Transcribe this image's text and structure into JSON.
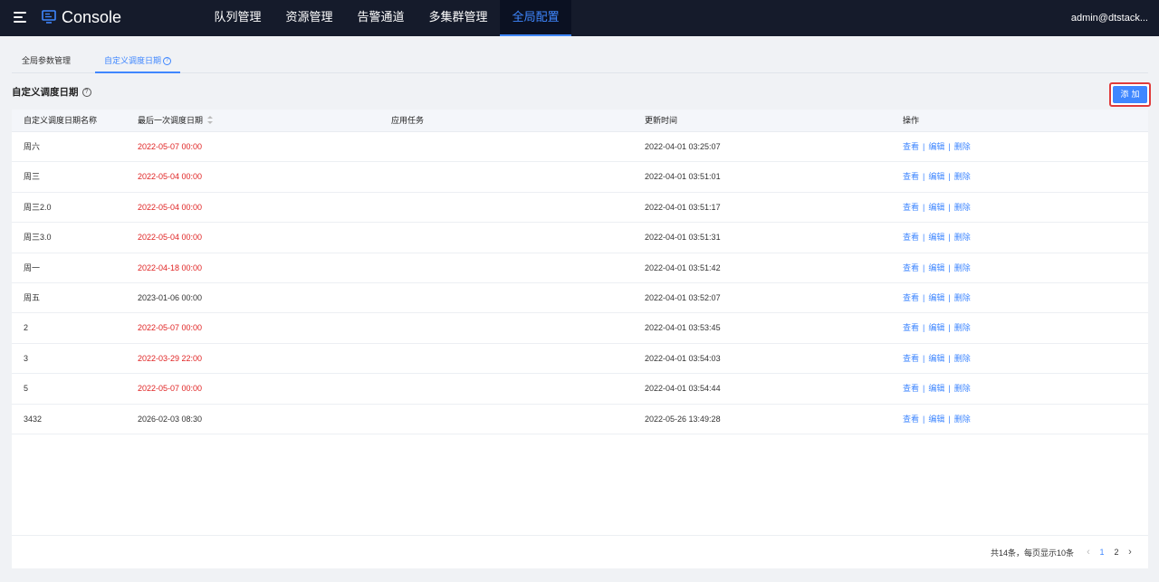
{
  "header": {
    "app_title": "Console",
    "nav": [
      "队列管理",
      "资源管理",
      "告警通道",
      "多集群管理",
      "全局配置"
    ],
    "active_nav": "全局配置",
    "user": "admin@dtstack..."
  },
  "tabs": [
    {
      "label": "全局参数管理",
      "active": false
    },
    {
      "label": "自定义调度日期",
      "active": true
    }
  ],
  "section": {
    "title": "自定义调度日期",
    "add_label": "添加"
  },
  "table": {
    "columns": [
      "自定义调度日期名称",
      "最后一次调度日期",
      "应用任务",
      "更新时间",
      "操作"
    ],
    "rows": [
      {
        "name": "周六",
        "last_date": "2022-05-07 00:00",
        "expired": true,
        "tasks": "",
        "updated": "2022-04-01 03:25:07"
      },
      {
        "name": "周三",
        "last_date": "2022-05-04 00:00",
        "expired": true,
        "tasks": "",
        "updated": "2022-04-01 03:51:01"
      },
      {
        "name": "周三2.0",
        "last_date": "2022-05-04 00:00",
        "expired": true,
        "tasks": "",
        "updated": "2022-04-01 03:51:17"
      },
      {
        "name": "周三3.0",
        "last_date": "2022-05-04 00:00",
        "expired": true,
        "tasks": "",
        "updated": "2022-04-01 03:51:31"
      },
      {
        "name": "周一",
        "last_date": "2022-04-18 00:00",
        "expired": true,
        "tasks": "",
        "updated": "2022-04-01 03:51:42"
      },
      {
        "name": "周五",
        "last_date": "2023-01-06 00:00",
        "expired": false,
        "tasks": "",
        "updated": "2022-04-01 03:52:07"
      },
      {
        "name": "2",
        "last_date": "2022-05-07 00:00",
        "expired": true,
        "tasks": "",
        "updated": "2022-04-01 03:53:45"
      },
      {
        "name": "3",
        "last_date": "2022-03-29 22:00",
        "expired": true,
        "tasks": "",
        "updated": "2022-04-01 03:54:03"
      },
      {
        "name": "5",
        "last_date": "2022-05-07 00:00",
        "expired": true,
        "tasks": "",
        "updated": "2022-04-01 03:54:44"
      },
      {
        "name": "3432",
        "last_date": "2026-02-03 08:30",
        "expired": false,
        "tasks": "",
        "updated": "2022-05-26 13:49:28"
      }
    ],
    "actions": [
      "查看",
      "编辑",
      "删除"
    ]
  },
  "pagination": {
    "total_text": "共14条，每页显示10条",
    "pages": [
      "1",
      "2"
    ],
    "current": "1"
  },
  "colors": {
    "accent": "#3f87ff",
    "expired": "#e02424",
    "topbar": "#151b2b",
    "highlight_border": "#e03b3b"
  }
}
